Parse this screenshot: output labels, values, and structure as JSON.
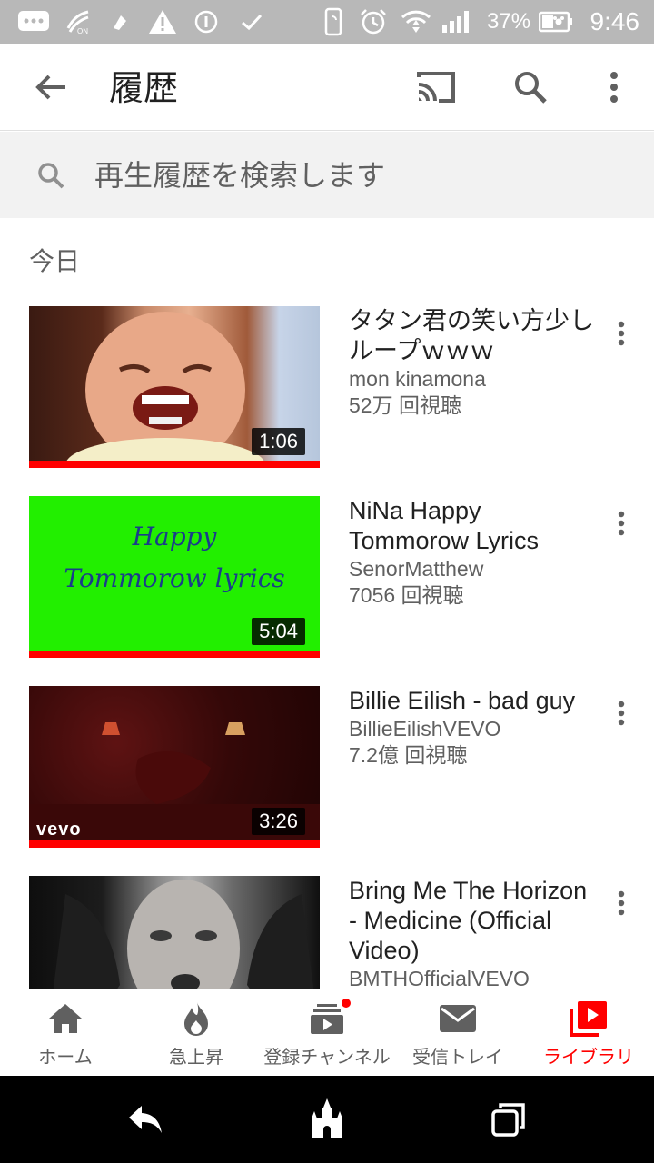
{
  "status_bar": {
    "battery": "37%",
    "time": "9:46"
  },
  "app_bar": {
    "title": "履歴"
  },
  "search": {
    "placeholder": "再生履歴を検索します"
  },
  "section": {
    "label": "今日"
  },
  "videos": [
    {
      "title": "タタン君の笑い方少しループｗｗｗ",
      "channel": "mon kinamona",
      "views": "52万 回視聴",
      "duration": "1:06",
      "watched_fraction": 1.0
    },
    {
      "title": "NiNa Happy Tommorow Lyrics",
      "channel": "SenorMatthew",
      "views": "7056 回視聴",
      "duration": "5:04",
      "thumb_text": [
        "Happy",
        "Tommorow lyrics"
      ],
      "watched_fraction": 1.0
    },
    {
      "title": "Billie Eilish - bad guy",
      "channel": "BillieEilishVEVO",
      "views": "7.2億 回視聴",
      "duration": "3:26",
      "thumb_text": "vevo",
      "watched_fraction": 1.0
    },
    {
      "title": "Bring Me The Horizon - Medicine (Official Video)",
      "channel": "BMTHOfficialVEVO",
      "views": "",
      "duration": ""
    }
  ],
  "bottom_nav": {
    "items": [
      {
        "label": "ホーム",
        "icon": "home-icon",
        "active": false
      },
      {
        "label": "急上昇",
        "icon": "flame-icon",
        "active": false
      },
      {
        "label": "登録チャンネル",
        "icon": "subscriptions-icon",
        "active": false,
        "badge": true
      },
      {
        "label": "受信トレイ",
        "icon": "mail-icon",
        "active": false
      },
      {
        "label": "ライブラリ",
        "icon": "library-icon",
        "active": true
      }
    ]
  },
  "colors": {
    "accent": "#ff0000",
    "status_bar": "#b8b8b8",
    "search_bg": "#f2f2f2",
    "secondary_text": "#606060",
    "thumb_green": "#22ef00"
  }
}
